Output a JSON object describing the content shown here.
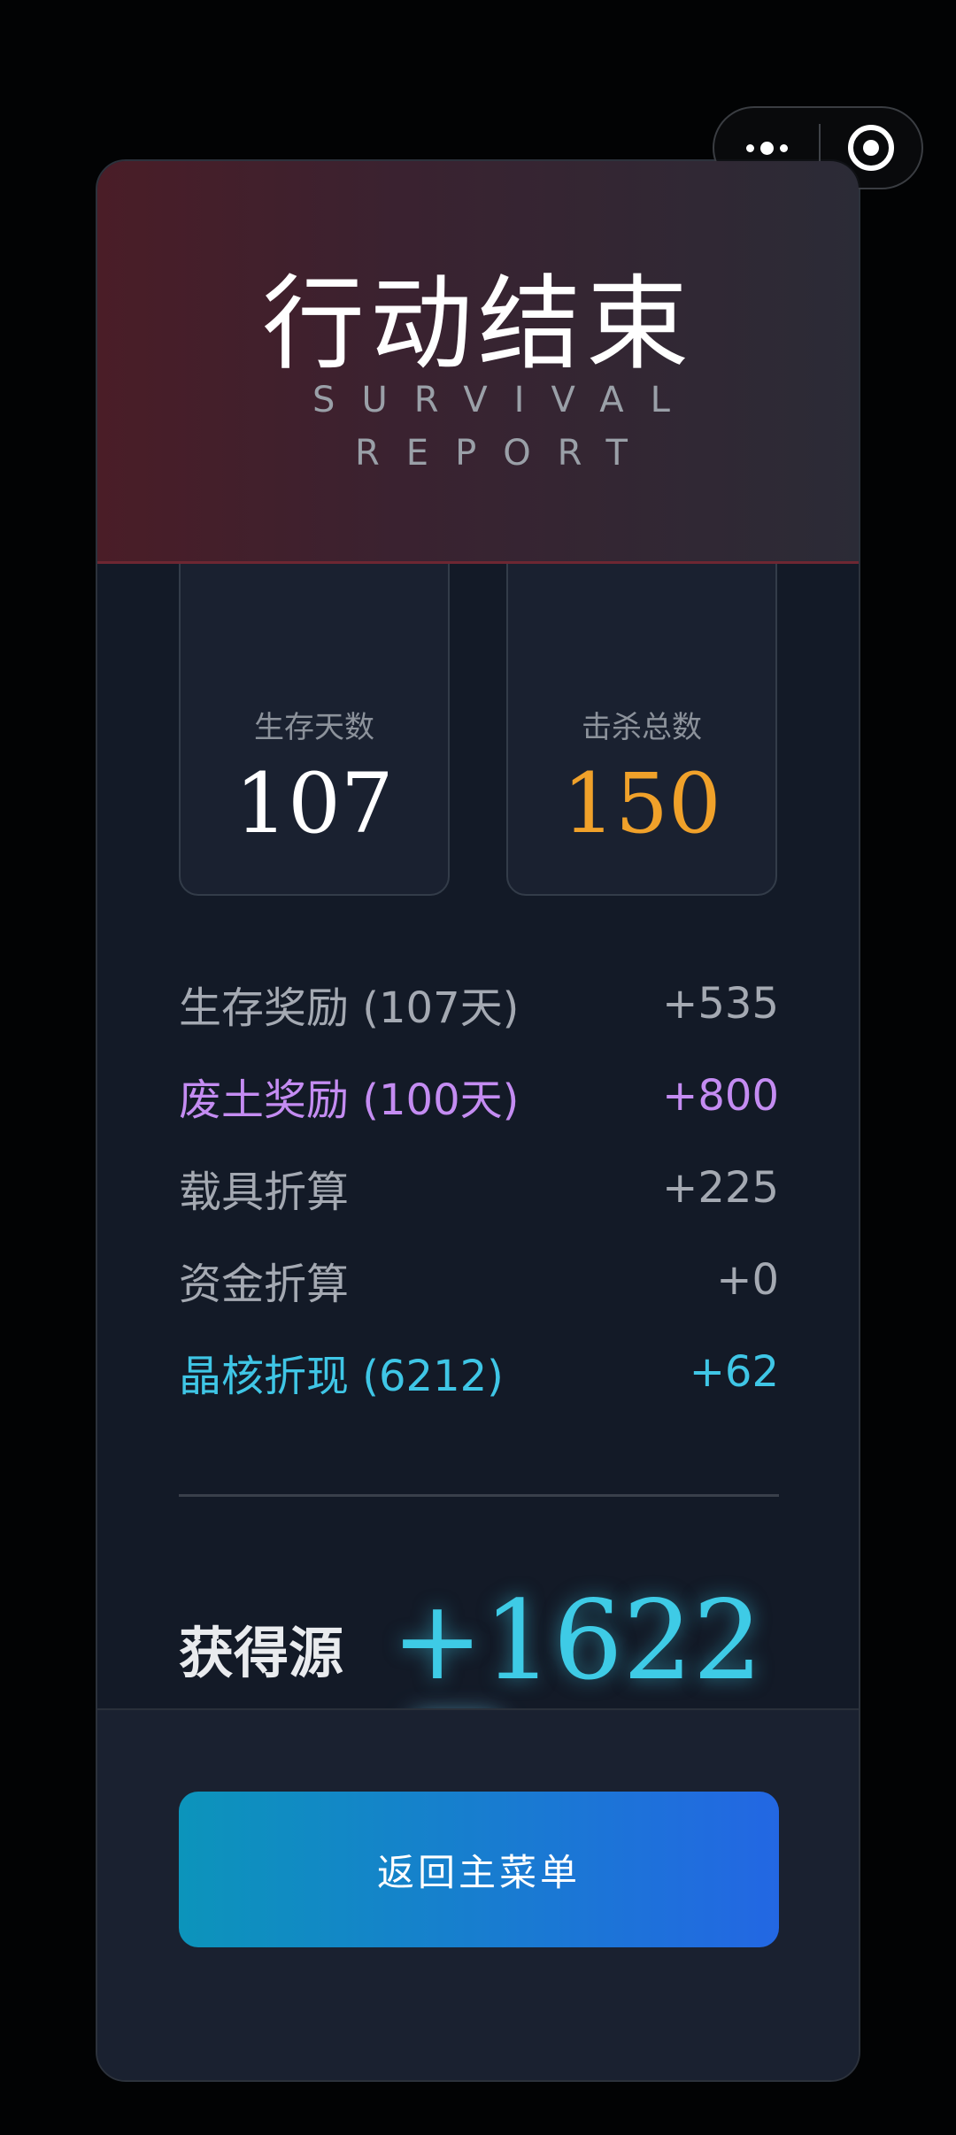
{
  "header": {
    "title": "行动结束",
    "subtitle": "SURVIVAL REPORT"
  },
  "stats": [
    {
      "label": "生存天数",
      "value": "107",
      "color": "#ffffff"
    },
    {
      "label": "击杀总数",
      "value": "150",
      "color": "#f0a12a"
    }
  ],
  "rewards": [
    {
      "label": "生存奖励 (107天)",
      "value": "+535",
      "color": "#a4a9b2"
    },
    {
      "label": "废土奖励 (100天)",
      "value": "+800",
      "color": "#c48cf2"
    },
    {
      "label": "载具折算",
      "value": "+225",
      "color": "#a4a9b2"
    },
    {
      "label": "资金折算",
      "value": "+0",
      "color": "#a4a9b2"
    },
    {
      "label": "晶核折现 (6212)",
      "value": "+62",
      "color": "#3fc6e6"
    }
  ],
  "total": {
    "label": "获得源晶",
    "value": "+1622",
    "icon": "diamond-icon"
  },
  "footer": {
    "button_label": "返回主菜单"
  },
  "capsule": {
    "more_icon": "more-dots-icon",
    "close_icon": "target-close-icon"
  }
}
